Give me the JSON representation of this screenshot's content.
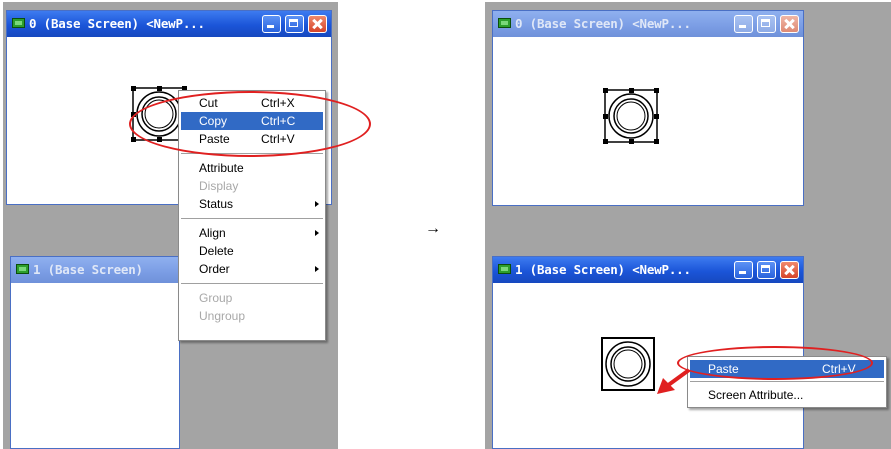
{
  "left": {
    "window_top": {
      "title": "0 (Base Screen) <NewP..."
    },
    "window_bottom": {
      "title": "1 (Base Screen)"
    },
    "context_menu": {
      "items": [
        {
          "label": "Cut",
          "shortcut": "Ctrl+X",
          "state": "normal"
        },
        {
          "label": "Copy",
          "shortcut": "Ctrl+C",
          "state": "selected"
        },
        {
          "label": "Paste",
          "shortcut": "Ctrl+V",
          "state": "normal"
        },
        {
          "label": "Attribute",
          "shortcut": "",
          "state": "normal"
        },
        {
          "label": "Display",
          "shortcut": "",
          "state": "disabled"
        },
        {
          "label": "Status",
          "shortcut": "",
          "state": "normal",
          "submenu": true
        },
        {
          "label": "Align",
          "shortcut": "",
          "state": "normal",
          "submenu": true
        },
        {
          "label": "Delete",
          "shortcut": "",
          "state": "normal"
        },
        {
          "label": "Order",
          "shortcut": "",
          "state": "normal",
          "submenu": true
        },
        {
          "label": "Group",
          "shortcut": "",
          "state": "disabled"
        },
        {
          "label": "Ungroup",
          "shortcut": "",
          "state": "disabled"
        }
      ]
    }
  },
  "step_arrow": "→",
  "right": {
    "window_top": {
      "title": "0 (Base Screen) <NewP..."
    },
    "window_bottom": {
      "title": "1 (Base Screen) <NewP..."
    },
    "context_menu": {
      "items": [
        {
          "label": "Paste",
          "shortcut": "Ctrl+V",
          "state": "selected"
        },
        {
          "label": "Screen Attribute...",
          "shortcut": "",
          "state": "normal"
        }
      ]
    }
  },
  "colors": {
    "highlight": "#e02020",
    "selection": "#316ac5",
    "titlebar": "#1b55d8"
  }
}
